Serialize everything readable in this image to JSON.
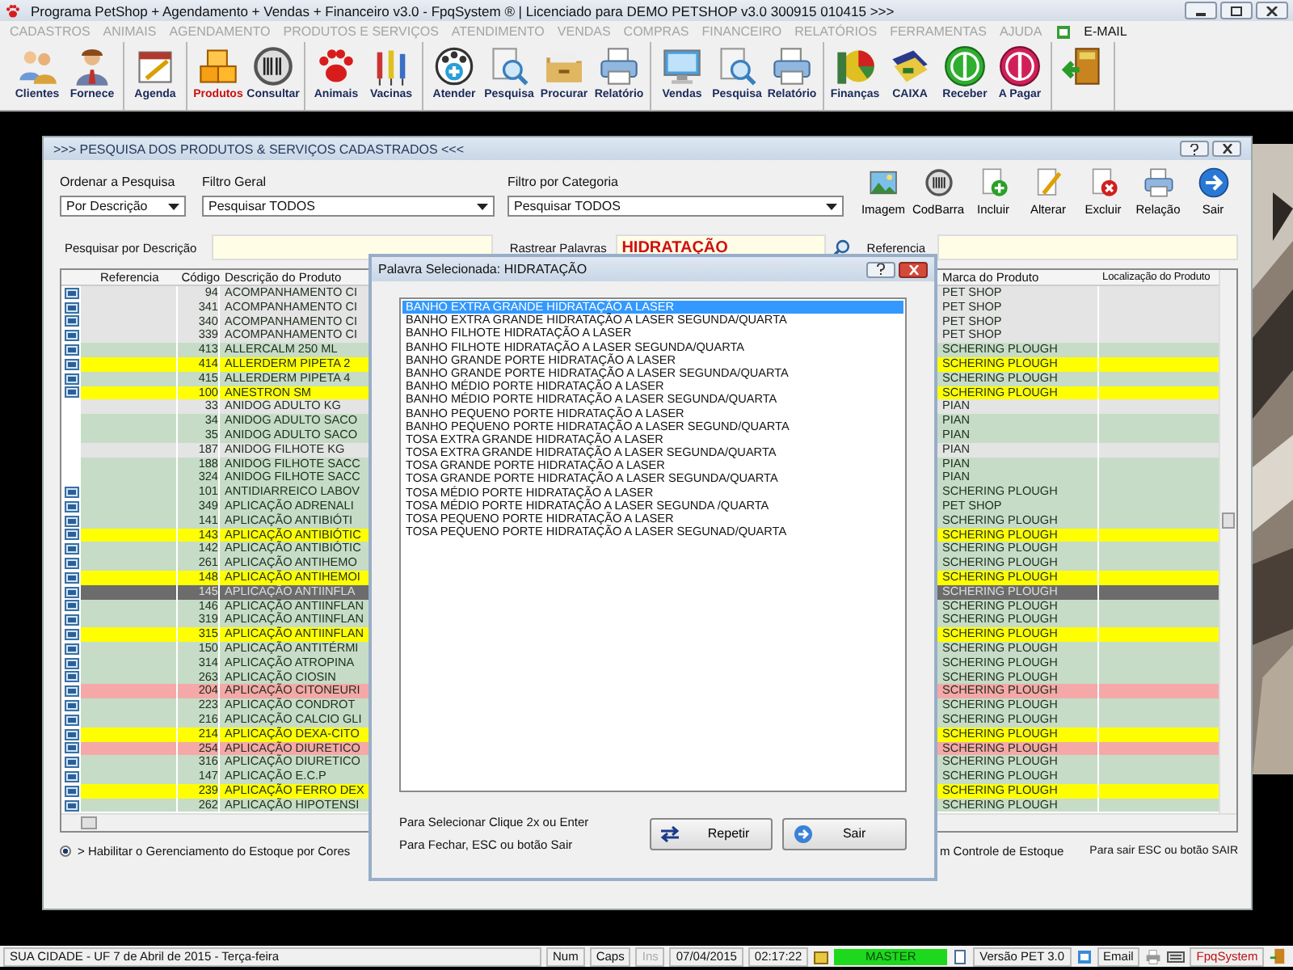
{
  "window": {
    "title": "Programa PetShop + Agendamento + Vendas + Financeiro v3.0 - FpqSystem ® | Licenciado para  DEMO PETSHOP v3.0 300915 010415 >>>"
  },
  "menu": [
    {
      "label": "CADASTROS",
      "disabled": true
    },
    {
      "label": "ANIMAIS",
      "disabled": true
    },
    {
      "label": "AGENDAMENTO",
      "disabled": true
    },
    {
      "label": "PRODUTOS E SERVIÇOS",
      "disabled": true
    },
    {
      "label": "ATENDIMENTO",
      "disabled": true
    },
    {
      "label": "VENDAS",
      "disabled": true
    },
    {
      "label": "COMPRAS",
      "disabled": true
    },
    {
      "label": "FINANCEIRO",
      "disabled": true
    },
    {
      "label": "RELATÓRIOS",
      "disabled": true
    },
    {
      "label": "FERRAMENTAS",
      "disabled": true
    },
    {
      "label": "AJUDA",
      "disabled": true
    },
    {
      "label": "E-MAIL",
      "disabled": false
    }
  ],
  "toolbar": [
    {
      "items": [
        {
          "label": "Clientes",
          "selected": false
        },
        {
          "label": "Fornece",
          "selected": false
        }
      ]
    },
    {
      "items": [
        {
          "label": "Agenda",
          "selected": false
        }
      ]
    },
    {
      "items": [
        {
          "label": "Produtos",
          "selected": true
        },
        {
          "label": "Consultar",
          "selected": false
        }
      ]
    },
    {
      "items": [
        {
          "label": "Animais",
          "selected": false
        },
        {
          "label": "Vacinas",
          "selected": false
        }
      ]
    },
    {
      "items": [
        {
          "label": "Atender",
          "selected": false
        },
        {
          "label": "Pesquisa",
          "selected": false
        },
        {
          "label": "Procurar",
          "selected": false
        },
        {
          "label": "Relatório",
          "selected": false
        }
      ]
    },
    {
      "items": [
        {
          "label": "Vendas",
          "selected": false
        },
        {
          "label": "Pesquisa",
          "selected": false
        },
        {
          "label": "Relatório",
          "selected": false
        }
      ]
    },
    {
      "items": [
        {
          "label": "Finanças",
          "selected": false
        },
        {
          "label": "CAIXA",
          "selected": false
        },
        {
          "label": "Receber",
          "selected": false
        },
        {
          "label": "A Pagar",
          "selected": false
        }
      ]
    },
    {
      "items": [
        {
          "selected": false
        }
      ]
    }
  ],
  "form": {
    "title": ">>>  PESQUISA DOS PRODUTOS & SERVIÇOS CADASTRADOS  <<<",
    "filters": [
      {
        "label": "Ordenar a Pesquisa",
        "value": "Por Descrição"
      },
      {
        "label": "Filtro Geral",
        "value": "Pesquisar TODOS"
      },
      {
        "label": "Filtro por Categoria",
        "value": "Pesquisar TODOS"
      }
    ],
    "actions": [
      "Imagem",
      "CodBarra",
      "Incluir",
      "Alterar",
      "Excluir",
      "Relação",
      "Sair"
    ],
    "search": {
      "description_label": "Pesquisar por Descrição",
      "track_label": "Rastrear Palavras",
      "track_value": "HIDRATAÇÃO",
      "reference_label": "Referencia"
    },
    "table": {
      "columns": [
        "Referencia",
        "Código",
        "Descrição do Produto",
        "Marca do Produto",
        "Localização do Produto"
      ],
      "rows": [
        {
          "code": "94",
          "description": "ACOMPANHAMENTO CI",
          "brand": "PET SHOP",
          "color": "#e4e4e4",
          "icon": true,
          "selected": false
        },
        {
          "code": "341",
          "description": "ACOMPANHAMENTO CI",
          "brand": "PET SHOP",
          "color": "#e4e4e4",
          "icon": true,
          "selected": false
        },
        {
          "code": "340",
          "description": "ACOMPANHAMENTO CI",
          "brand": "PET SHOP",
          "color": "#e4e4e4",
          "icon": true,
          "selected": false
        },
        {
          "code": "339",
          "description": "ACOMPANHAMENTO CI",
          "brand": "PET SHOP",
          "color": "#e4e4e4",
          "icon": true,
          "selected": false
        },
        {
          "code": "413",
          "description": "ALLERCALM 250 ML",
          "brand": "SCHERING PLOUGH",
          "color": "#c6dcc6",
          "icon": true,
          "selected": false
        },
        {
          "code": "414",
          "description": "ALLERDERM PIPETA 2",
          "brand": "SCHERING PLOUGH",
          "color": "#ffff00",
          "icon": true,
          "selected": false
        },
        {
          "code": "415",
          "description": "ALLERDERM PIPETA 4",
          "brand": "SCHERING PLOUGH",
          "color": "#c6dcc6",
          "icon": true,
          "selected": false
        },
        {
          "code": "100",
          "description": "ANESTRON SM",
          "brand": "SCHERING PLOUGH",
          "color": "#ffff00",
          "icon": true,
          "selected": false
        },
        {
          "code": "33",
          "description": "ANIDOG ADULTO KG",
          "brand": "PIAN",
          "color": "#e4e4e4",
          "icon": false,
          "selected": false
        },
        {
          "code": "34",
          "description": "ANIDOG ADULTO SACO",
          "brand": "PIAN",
          "color": "#c6dcc6",
          "icon": false,
          "selected": false
        },
        {
          "code": "35",
          "description": "ANIDOG ADULTO SACO",
          "brand": "PIAN",
          "color": "#c6dcc6",
          "icon": false,
          "selected": false
        },
        {
          "code": "187",
          "description": "ANIDOG FILHOTE KG",
          "brand": "PIAN",
          "color": "#e4e4e4",
          "icon": false,
          "selected": false
        },
        {
          "code": "188",
          "description": "ANIDOG FILHOTE SACC",
          "brand": "PIAN",
          "color": "#c6dcc6",
          "icon": false,
          "selected": false
        },
        {
          "code": "324",
          "description": "ANIDOG FILHOTE SACC",
          "brand": "PIAN",
          "color": "#c6dcc6",
          "icon": false,
          "selected": false
        },
        {
          "code": "101",
          "description": "ANTIDIARREICO LABOV",
          "brand": "SCHERING PLOUGH",
          "color": "#c6dcc6",
          "icon": true,
          "selected": false
        },
        {
          "code": "349",
          "description": "APLICAÇÃO ADRENALI",
          "brand": "PET SHOP",
          "color": "#c6dcc6",
          "icon": true,
          "selected": false
        },
        {
          "code": "141",
          "description": "APLICAÇÃO ANTIBIÓTI",
          "brand": "SCHERING PLOUGH",
          "color": "#c6dcc6",
          "icon": true,
          "selected": false
        },
        {
          "code": "143",
          "description": "APLICAÇÃO ANTIBIÓTIC",
          "brand": "SCHERING PLOUGH",
          "color": "#ffff00",
          "icon": true,
          "selected": false
        },
        {
          "code": "142",
          "description": "APLICAÇÃO ANTIBIÓTIC",
          "brand": "SCHERING PLOUGH",
          "color": "#c6dcc6",
          "icon": true,
          "selected": false
        },
        {
          "code": "261",
          "description": "APLICAÇÃO ANTIHEMO",
          "brand": "SCHERING PLOUGH",
          "color": "#c6dcc6",
          "icon": true,
          "selected": false
        },
        {
          "code": "148",
          "description": "APLICAÇÃO ANTIHEMOI",
          "brand": "SCHERING PLOUGH",
          "color": "#ffff00",
          "icon": true,
          "selected": false
        },
        {
          "code": "145",
          "description": "APLICAÇÃO ANTIINFLA",
          "brand": "SCHERING PLOUGH",
          "color": "#6c6c6c",
          "icon": true,
          "selected": true
        },
        {
          "code": "146",
          "description": "APLICAÇÃO ANTIINFLAN",
          "brand": "SCHERING PLOUGH",
          "color": "#c6dcc6",
          "icon": true,
          "selected": false
        },
        {
          "code": "319",
          "description": "APLICAÇÃO ANTIINFLAN",
          "brand": "SCHERING PLOUGH",
          "color": "#c6dcc6",
          "icon": true,
          "selected": false
        },
        {
          "code": "315",
          "description": "APLICAÇÃO ANTIINFLAN",
          "brand": "SCHERING PLOUGH",
          "color": "#ffff00",
          "icon": true,
          "selected": false
        },
        {
          "code": "150",
          "description": "APLICAÇÃO ANTITÉRMI",
          "brand": "SCHERING PLOUGH",
          "color": "#c6dcc6",
          "icon": true,
          "selected": false
        },
        {
          "code": "314",
          "description": "APLICAÇÃO ATROPINA",
          "brand": "SCHERING PLOUGH",
          "color": "#c6dcc6",
          "icon": true,
          "selected": false
        },
        {
          "code": "263",
          "description": "APLICAÇÃO CIOSIN",
          "brand": "SCHERING PLOUGH",
          "color": "#c6dcc6",
          "icon": true,
          "selected": false
        },
        {
          "code": "204",
          "description": "APLICAÇÃO CITONEURI",
          "brand": "SCHERING PLOUGH",
          "color": "#f5a8a8",
          "icon": true,
          "selected": false
        },
        {
          "code": "223",
          "description": "APLICAÇÃO CONDROT",
          "brand": "SCHERING PLOUGH",
          "color": "#c6dcc6",
          "icon": true,
          "selected": false
        },
        {
          "code": "216",
          "description": "APLICAÇÃO CALCIO GLI",
          "brand": "SCHERING PLOUGH",
          "color": "#c6dcc6",
          "icon": true,
          "selected": false
        },
        {
          "code": "214",
          "description": "APLICAÇÃO DEXA-CITO",
          "brand": "SCHERING PLOUGH",
          "color": "#ffff00",
          "icon": true,
          "selected": false
        },
        {
          "code": "254",
          "description": "APLICAÇÃO DIURETICO",
          "brand": "SCHERING PLOUGH",
          "color": "#f5a8a8",
          "icon": true,
          "selected": false
        },
        {
          "code": "316",
          "description": "APLICAÇÃO DIURETICO",
          "brand": "SCHERING PLOUGH",
          "color": "#c6dcc6",
          "icon": true,
          "selected": false
        },
        {
          "code": "147",
          "description": "APLICAÇÃO E.C.P",
          "brand": "SCHERING PLOUGH",
          "color": "#c6dcc6",
          "icon": true,
          "selected": false
        },
        {
          "code": "239",
          "description": "APLICAÇÃO FERRO DEX",
          "brand": "SCHERING PLOUGH",
          "color": "#ffff00",
          "icon": true,
          "selected": false
        },
        {
          "code": "262",
          "description": "APLICAÇÃO HIPOTENSI",
          "brand": "SCHERING PLOUGH",
          "color": "#c6dcc6",
          "icon": true,
          "selected": false
        }
      ]
    },
    "color_option": {
      "label": "> Habilitar o Gerenciamento do Estoque por Cores",
      "selected": true
    },
    "stock_note": "m Controle de Estoque",
    "exit_hint": "Para sair ESC ou botão SAIR"
  },
  "dialog": {
    "title": "Palavra Selecionada: HIDRATAÇÃO",
    "items": [
      {
        "label": "BANHO EXTRA GRANDE HIDRATAÇÃO A LASER",
        "selected": true
      },
      {
        "label": "BANHO EXTRA GRANDE HIDRATAÇÃO A LASER SEGUNDA/QUARTA",
        "selected": false
      },
      {
        "label": "BANHO FILHOTE HIDRATAÇÃO A LASER",
        "selected": false
      },
      {
        "label": "BANHO FILHOTE HIDRATAÇÃO A LASER SEGUNDA/QUARTA",
        "selected": false
      },
      {
        "label": "BANHO GRANDE PORTE HIDRATAÇÃO A LASER",
        "selected": false
      },
      {
        "label": "BANHO GRANDE PORTE HIDRATAÇÃO A LASER SEGUNDA/QUARTA",
        "selected": false
      },
      {
        "label": "BANHO MÉDIO PORTE HIDRATAÇÃO A LASER",
        "selected": false
      },
      {
        "label": "BANHO MÉDIO PORTE HIDRATAÇÃO A LASER SEGUNDA/QUARTA",
        "selected": false
      },
      {
        "label": "BANHO PEQUENO PORTE HIDRATAÇÃO A LASER",
        "selected": false
      },
      {
        "label": "BANHO PEQUENO PORTE HIDRATAÇÃO A LASER SEGUND/QUARTA",
        "selected": false
      },
      {
        "label": "TOSA EXTRA GRANDE HIDRATAÇÃO A LASER",
        "selected": false
      },
      {
        "label": "TOSA EXTRA GRANDE HIDRATAÇÃO A LASER SEGUNDA/QUARTA",
        "selected": false
      },
      {
        "label": "TOSA GRANDE PORTE HIDRATAÇÃO A LASER",
        "selected": false
      },
      {
        "label": "TOSA GRANDE PORTE HIDRATAÇÃO A LASER SEGUNDA/QUARTA",
        "selected": false
      },
      {
        "label": "TOSA MÉDIO PORTE HIDRATAÇÃO A LASER",
        "selected": false
      },
      {
        "label": "TOSA MÉDIO PORTE HIDRATAÇÃO A LASER SEGUNDA /QUARTA",
        "selected": false
      },
      {
        "label": "TOSA PEQUENO PORTE HIDRATAÇÃO A LASER",
        "selected": false
      },
      {
        "label": "TOSA PEQUENO PORTE HIDRATAÇÃO A LASER SEGUNAD/QUARTA",
        "selected": false
      }
    ],
    "hints": [
      "Para Selecionar Clique 2x ou Enter",
      "Para Fechar, ESC ou botão Sair"
    ],
    "buttons": [
      "Repetir",
      "Sair"
    ]
  },
  "status_bar": {
    "location": "SUA CIDADE - UF  7 de Abril de 2015 - Terça-feira",
    "keys": [
      {
        "label": "Num",
        "disabled": false
      },
      {
        "label": "Caps",
        "disabled": false
      },
      {
        "label": "Ins",
        "disabled": true
      }
    ],
    "date": "07/04/2015",
    "time": "02:17:22",
    "user": "MASTER",
    "version": "Versão PET 3.0",
    "email": "Email",
    "brand": "FpqSystem"
  }
}
